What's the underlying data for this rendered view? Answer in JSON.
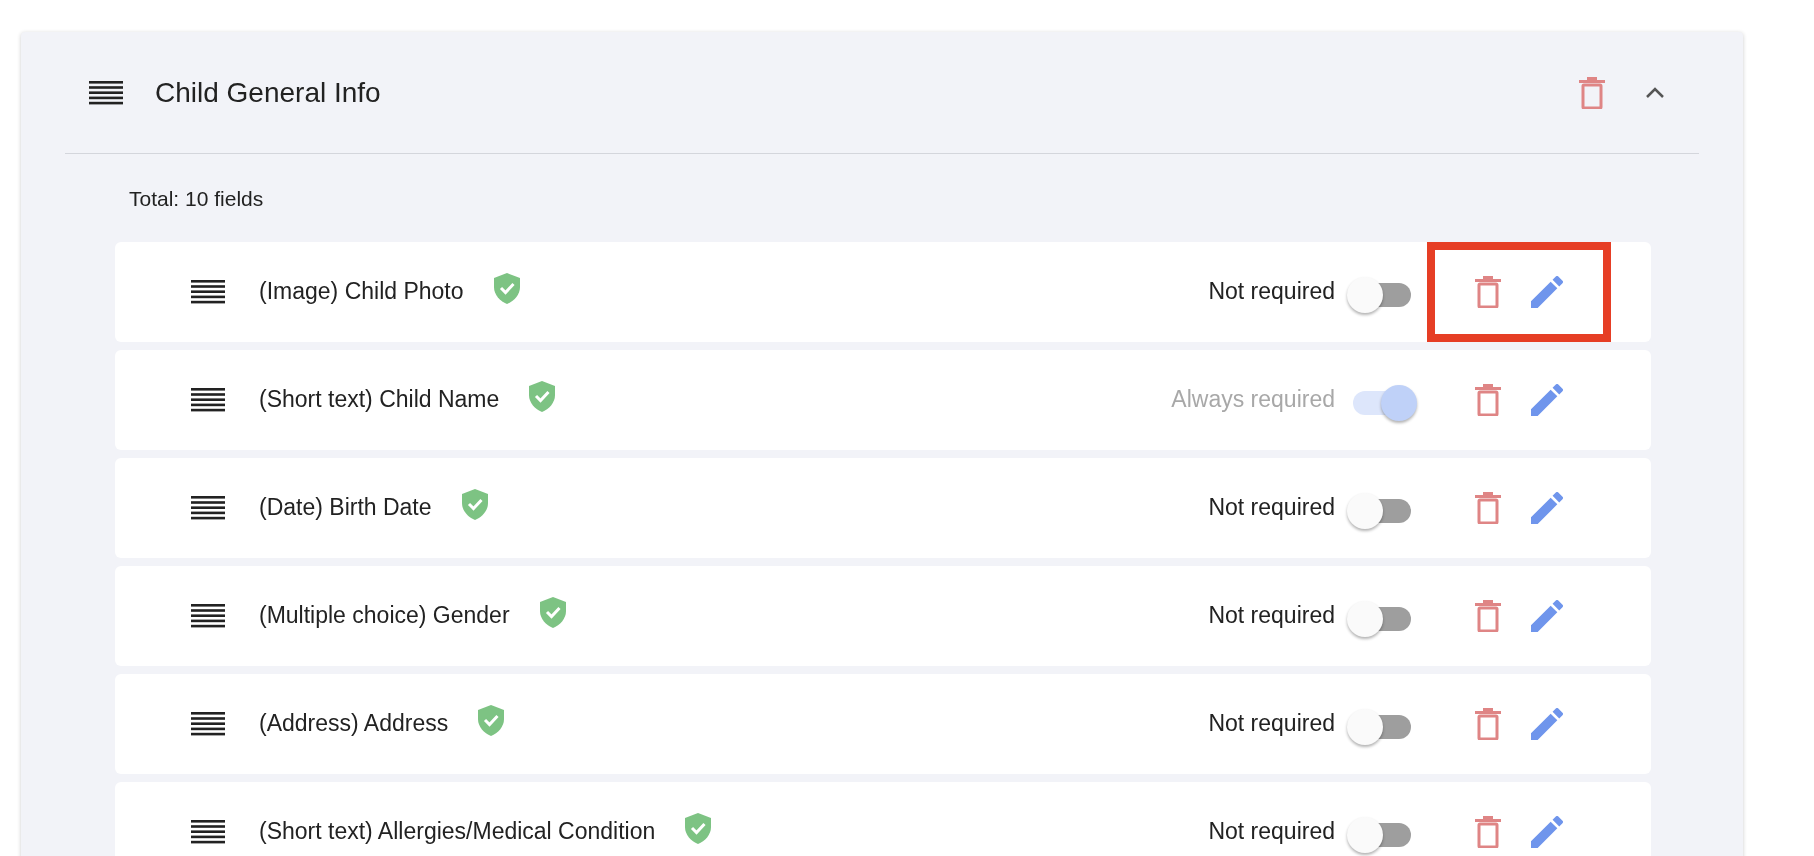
{
  "section": {
    "title": "Child General Info",
    "expanded": true,
    "total": "Total: 10 fields"
  },
  "fields": [
    {
      "label": "(Image) Child Photo",
      "verified": true,
      "required_label": "Not required",
      "on": false,
      "disabled": false,
      "highlighted": true
    },
    {
      "label": "(Short text) Child Name",
      "verified": true,
      "required_label": "Always required",
      "on": true,
      "disabled": true,
      "highlighted": false
    },
    {
      "label": "(Date) Birth Date",
      "verified": true,
      "required_label": "Not required",
      "on": false,
      "disabled": false,
      "highlighted": false
    },
    {
      "label": "(Multiple choice) Gender",
      "verified": true,
      "required_label": "Not required",
      "on": false,
      "disabled": false,
      "highlighted": false
    },
    {
      "label": "(Address) Address",
      "verified": true,
      "required_label": "Not required",
      "on": false,
      "disabled": false,
      "highlighted": false
    },
    {
      "label": "(Short text) Allergies/Medical Condition",
      "verified": true,
      "required_label": "Not required",
      "on": false,
      "disabled": false,
      "highlighted": false
    }
  ]
}
